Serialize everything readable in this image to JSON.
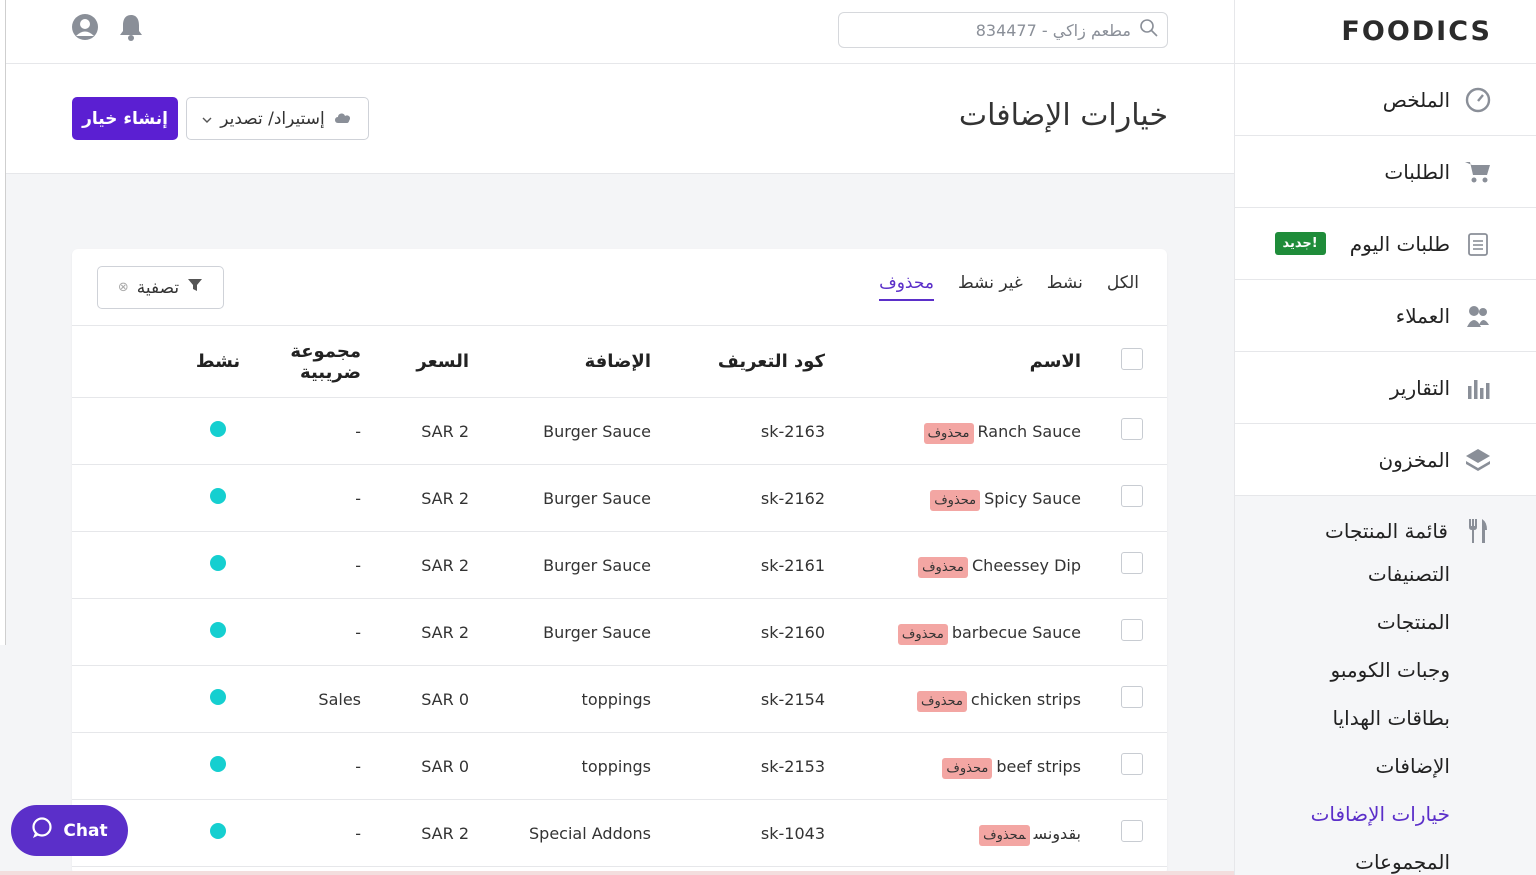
{
  "brand": {
    "logo": "FOODICS",
    "accent": "#5b2fc9",
    "button": "#5b1fd2"
  },
  "topbar": {
    "search_placeholder": "مطعم زاكي - 834477",
    "bell_icon": "bell-icon",
    "user_icon": "user-icon"
  },
  "header": {
    "title": "خيارات الإضافات",
    "import_label": "إستيراد/ تصدير",
    "create_label": "إنشاء خيار"
  },
  "sidebar": {
    "items": [
      {
        "label": "الملخص",
        "icon": "dashboard-icon"
      },
      {
        "label": "الطلبات",
        "icon": "cart-icon"
      },
      {
        "label": "طلبات اليوم",
        "icon": "clipboard-icon",
        "badge": "جديد!"
      },
      {
        "label": "العملاء",
        "icon": "users-icon"
      },
      {
        "label": "التقارير",
        "icon": "bar-chart-icon"
      },
      {
        "label": "المخزون",
        "icon": "layers-icon"
      }
    ],
    "menu_group": "قائمة المنتجات",
    "sub_items": [
      {
        "label": "التصنيفات"
      },
      {
        "label": "المنتجات"
      },
      {
        "label": "وجبات الكومبو"
      },
      {
        "label": "بطاقات الهدايا"
      },
      {
        "label": "الإضافات"
      },
      {
        "label": "خيارات الإضافات",
        "active": true
      },
      {
        "label": "المجموعات"
      }
    ]
  },
  "tabs": [
    {
      "label": "الكل"
    },
    {
      "label": "نشط"
    },
    {
      "label": "غير نشط"
    },
    {
      "label": "محذوف",
      "active": true
    }
  ],
  "filter_label": "تصفية",
  "table": {
    "headers": {
      "name": "الاسم",
      "sku": "كود التعريف",
      "modifier": "الإضافة",
      "price": "السعر",
      "tax_group": "مجموعة ضريبية",
      "active": "نشط"
    },
    "deleted_tag": "محذوف",
    "rows": [
      {
        "name": "Ranch Sauce",
        "sku": "sk-2163",
        "modifier": "Burger Sauce",
        "price": "SAR 2",
        "tax_group": "-"
      },
      {
        "name": "Spicy Sauce",
        "sku": "sk-2162",
        "modifier": "Burger Sauce",
        "price": "SAR 2",
        "tax_group": "-"
      },
      {
        "name": "Cheessey Dip",
        "sku": "sk-2161",
        "modifier": "Burger Sauce",
        "price": "SAR 2",
        "tax_group": "-"
      },
      {
        "name": "barbecue Sauce",
        "sku": "sk-2160",
        "modifier": "Burger Sauce",
        "price": "SAR 2",
        "tax_group": "-"
      },
      {
        "name": "chicken strips",
        "sku": "sk-2154",
        "modifier": "toppings",
        "price": "SAR 0",
        "tax_group": "Sales"
      },
      {
        "name": "beef strips",
        "sku": "sk-2153",
        "modifier": "toppings",
        "price": "SAR 0",
        "tax_group": "-"
      },
      {
        "name": "بقدونس",
        "sku": "sk-1043",
        "modifier": "Special Addons",
        "price": "SAR 2",
        "tax_group": "-"
      }
    ]
  },
  "chat": {
    "label": "Chat"
  },
  "status_color": "#15cfd0"
}
